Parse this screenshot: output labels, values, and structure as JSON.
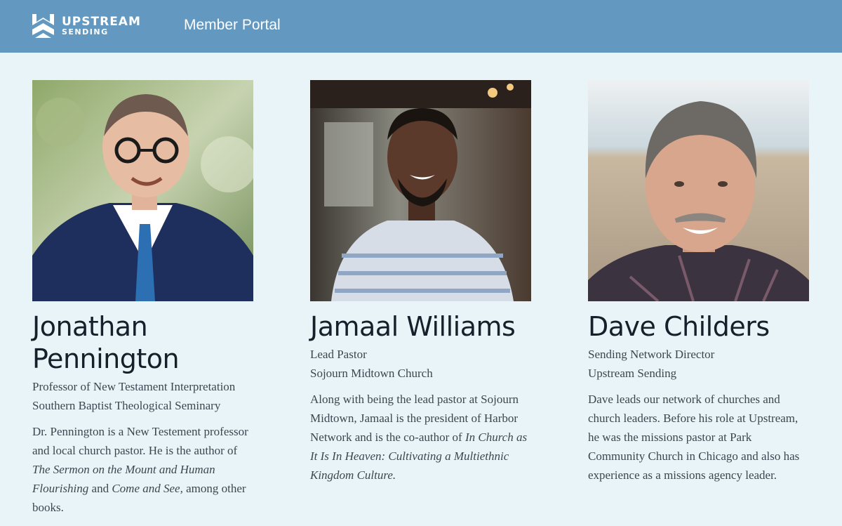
{
  "header": {
    "logo_word": "UPSTREAM",
    "logo_sub": "SENDING",
    "nav_label": "Member Portal",
    "bar_color": "#6398c0"
  },
  "people": [
    {
      "name_line1": "Jonathan",
      "name_line2": "Pennington",
      "role": "Professor of New Testament Interpretation",
      "org": "Southern Baptist Theological Seminary",
      "bio": [
        {
          "text": "Dr. Pennington is a New Testement professor and local church pastor. He is the author of "
        },
        {
          "text": "The Sermon on the Mount and Human Flourishing",
          "italic": true
        },
        {
          "text": " and "
        },
        {
          "text": "Come and See,",
          "italic": true
        },
        {
          "text": " among other books."
        }
      ]
    },
    {
      "name": "Jamaal Williams",
      "role": "Lead Pastor",
      "org": "Sojourn Midtown Church",
      "bio": [
        {
          "text": "Along with being the lead pastor at Sojourn Midtown, Jamaal is the president of Harbor Network and is the co-author of "
        },
        {
          "text": "In Church as It Is In Heaven: Cultivating a Multiethnic Kingdom Culture.",
          "italic": true
        }
      ]
    },
    {
      "name": "Dave Childers",
      "role": "Sending Network Director",
      "org": "Upstream Sending",
      "bio": [
        {
          "text": "Dave leads our network of churches and church leaders. Before his role at Upstream, he was the missions pastor at Park Community Church in Chicago and also has experience as a missions agency leader."
        }
      ]
    }
  ]
}
